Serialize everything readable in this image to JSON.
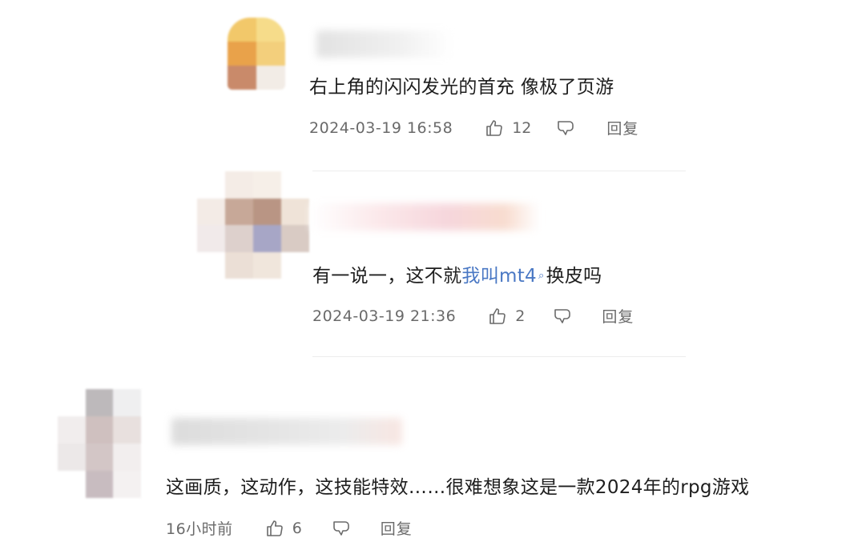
{
  "comments": [
    {
      "text": "右上角的闪闪发光的首充 像极了页游",
      "time": "2024-03-19 16:58",
      "likes": "12",
      "reply_label": "回复",
      "like_icon": "thumbs-up-icon",
      "dislike_icon": "thumbs-down-icon"
    },
    {
      "text_before": "有一说一，这不就",
      "link_text": "我叫mt4",
      "text_after": "换皮吗",
      "time": "2024-03-19 21:36",
      "likes": "2",
      "reply_label": "回复",
      "like_icon": "thumbs-up-icon",
      "dislike_icon": "thumbs-down-icon"
    },
    {
      "text": "这画质，这动作，这技能特效……很难想象这是一款2024年的rpg游戏",
      "time": "16小时前",
      "likes": "6",
      "reply_label": "回复",
      "like_icon": "thumbs-up-icon",
      "dislike_icon": "thumbs-down-icon"
    }
  ],
  "colors": {
    "link": "#4a78c4",
    "meta_text": "#6a6a6a",
    "divider": "#ededed"
  }
}
